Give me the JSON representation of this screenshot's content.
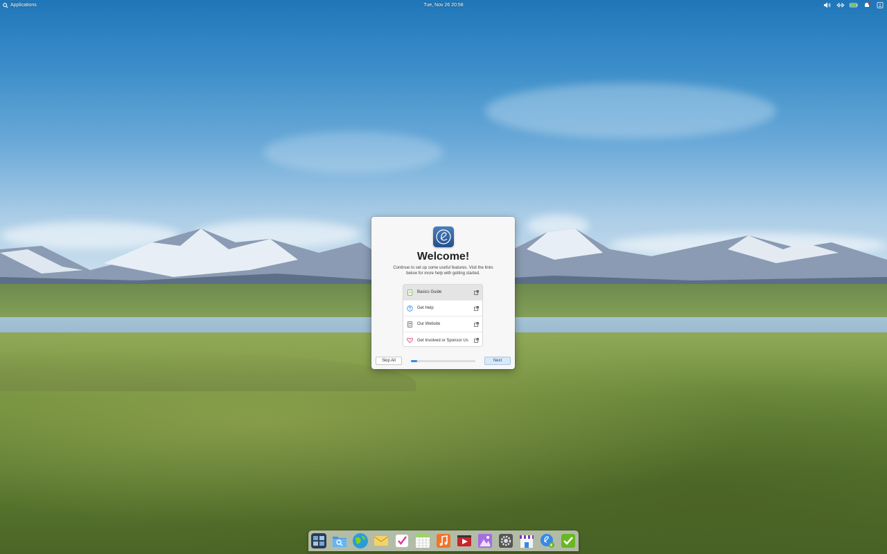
{
  "top_panel": {
    "applications_label": "Applications",
    "clock": "Tue, Nov 26  20:58",
    "indicators": [
      "volume-icon",
      "network-icon",
      "battery-icon",
      "notifications-icon",
      "power-icon"
    ]
  },
  "welcome": {
    "title": "Welcome!",
    "description": "Continue to set up some useful features. Visit the links below for more help with getting started.",
    "links": [
      {
        "label": "Basics Guide",
        "icon": "document-icon",
        "active": true
      },
      {
        "label": "Get Help",
        "icon": "help-icon"
      },
      {
        "label": "Our Website",
        "icon": "website-icon"
      },
      {
        "label": "Get Involved or Sponsor Us",
        "icon": "heart-icon"
      }
    ],
    "skip_label": "Skip All",
    "next_label": "Next",
    "progress": 0.1
  },
  "dock": {
    "apps": [
      "multitasking-view-icon",
      "files-icon",
      "web-browser-icon",
      "mail-icon",
      "tasks-icon",
      "calendar-icon",
      "music-icon",
      "videos-icon",
      "photos-icon",
      "system-settings-icon",
      "appcenter-icon",
      "initial-setup-icon",
      "updates-icon"
    ]
  },
  "colors": {
    "accent": "#3689e6",
    "dialog_bg": "#f7f7f7"
  }
}
